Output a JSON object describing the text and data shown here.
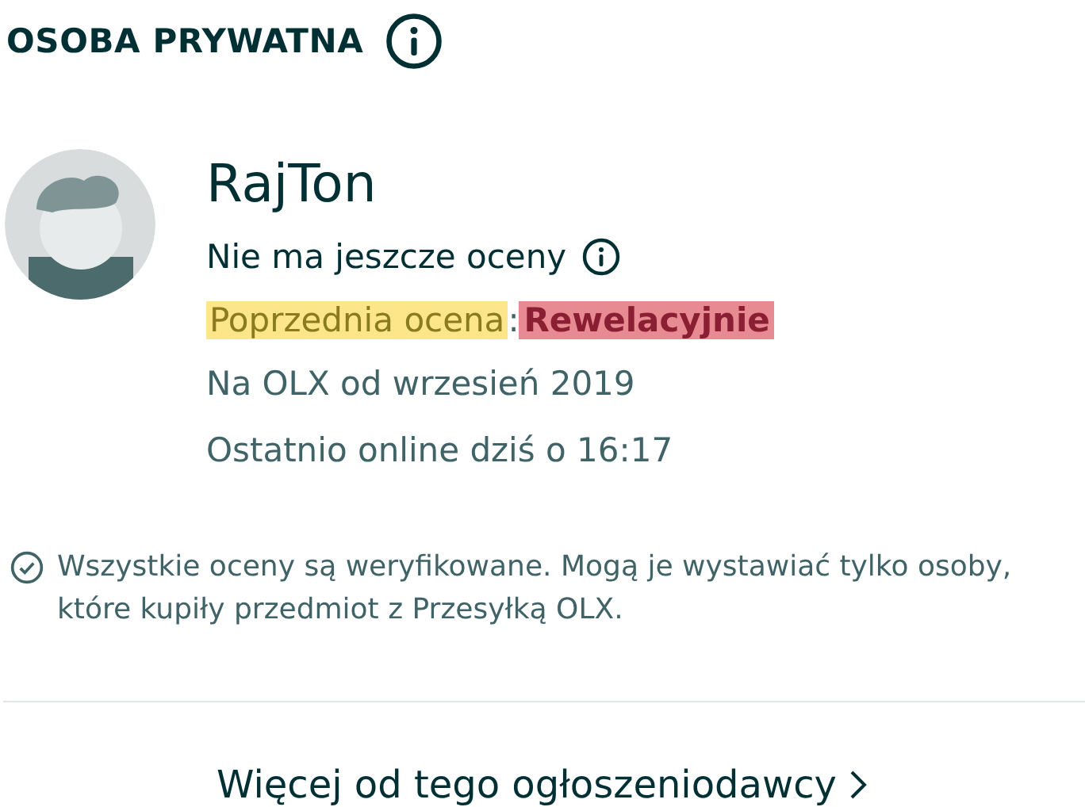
{
  "header": {
    "title": "OSOBA PRYWATNA"
  },
  "seller": {
    "name": "RajTon",
    "rating_status": "Nie ma jeszcze oceny",
    "previous_rating": {
      "label": "Poprzednia ocena",
      "separator": ":",
      "value": "Rewelacyjnie"
    },
    "member_since": "Na OLX od wrzesień 2019",
    "last_online": "Ostatnio online dziś o 16:17"
  },
  "verification_note": "Wszystkie oceny są weryfikowane. Mogą je wystawiać tylko osoby, które kupiły przedmiot z Przesyłką OLX.",
  "more_link": "Więcej od tego ogłoszeniodawcy"
}
